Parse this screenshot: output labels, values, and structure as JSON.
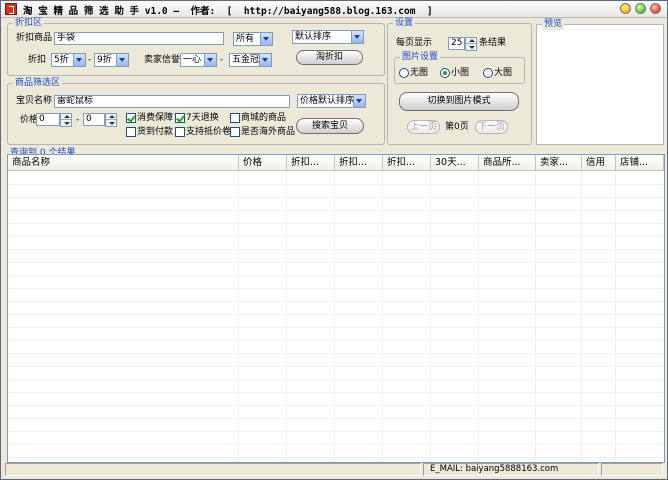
{
  "window": {
    "title": "淘 宝 精 品 筛 选 助 手 v1.0 —  作者:  [  http://baiyang588.blog.163.com  ]"
  },
  "discount": {
    "legend": "折扣区",
    "product_label": "折扣商品",
    "product_value": "手袋",
    "scope_value": "所有",
    "sort_value": "默认排序",
    "discount_label": "折扣",
    "discount_from": "5折",
    "discount_dash": "-",
    "discount_to": "9折",
    "seller_credit_label": "卖家信誉",
    "credit_from": "一心",
    "credit_dash": "-",
    "credit_to": "五金冠",
    "search_button": "淘折扣"
  },
  "filter": {
    "legend": "商品筛选区",
    "name_label": "宝贝名称",
    "name_value": "雷蛇鼠标",
    "sort_value": "价格默认排序",
    "price_label": "价格",
    "price_from": "0",
    "price_dash": "-",
    "price_to": "0",
    "checkboxes": [
      {
        "label": "消费保障",
        "checked": true
      },
      {
        "label": "7天退换",
        "checked": true
      },
      {
        "label": "商城的商品",
        "checked": false
      },
      {
        "label": "货到付款",
        "checked": false
      },
      {
        "label": "支持抵价卷",
        "checked": false
      },
      {
        "label": "是否海外商品",
        "checked": false
      }
    ],
    "search_button": "搜索宝贝"
  },
  "settings": {
    "legend": "设置",
    "per_page_label": "每页显示",
    "per_page_value": "25",
    "per_page_suffix": "条结果",
    "image_legend": "图片设置",
    "image_options": [
      {
        "label": "无图",
        "selected": false
      },
      {
        "label": "小图",
        "selected": true
      },
      {
        "label": "大图",
        "selected": false
      }
    ],
    "mode_button": "切换到图片模式",
    "prev_button": "上一页",
    "page_text": "第0页",
    "next_button": "下一页"
  },
  "preview": {
    "legend": "预览"
  },
  "results": {
    "summary": "查询到 0 个结果",
    "columns": [
      "商品名称",
      "价格",
      "折扣...",
      "折扣...",
      "折扣...",
      "30天...",
      "商品所...",
      "卖家...",
      "信用",
      "店铺..."
    ],
    "rows": []
  },
  "status": {
    "left": "",
    "email": "E_MAIL:  baiyang5888163.com",
    "right": ""
  },
  "colors": {
    "accent_blue": "#1e4bd1",
    "window_bg": "#ece9d8",
    "check_green": "#21a121"
  }
}
